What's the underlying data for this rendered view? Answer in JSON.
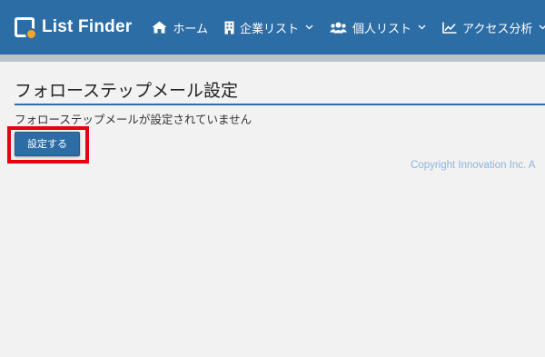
{
  "header": {
    "brand": "List Finder",
    "nav": [
      {
        "label": "ホーム",
        "icon": "home-icon"
      },
      {
        "label": "企業リスト",
        "icon": "building-icon"
      },
      {
        "label": "個人リスト",
        "icon": "users-icon"
      },
      {
        "label": "アクセス分析",
        "icon": "chart-icon"
      }
    ]
  },
  "main": {
    "title": "フォローステップメール設定",
    "message": "フォローステップメールが設定されていません",
    "setup_button": "設定する"
  },
  "footer": {
    "copyright": "Copyright Innovation Inc. A"
  },
  "colors": {
    "header_bg": "#2d6da6",
    "highlight": "#e60012",
    "copyright_text": "#8fb3dd"
  }
}
